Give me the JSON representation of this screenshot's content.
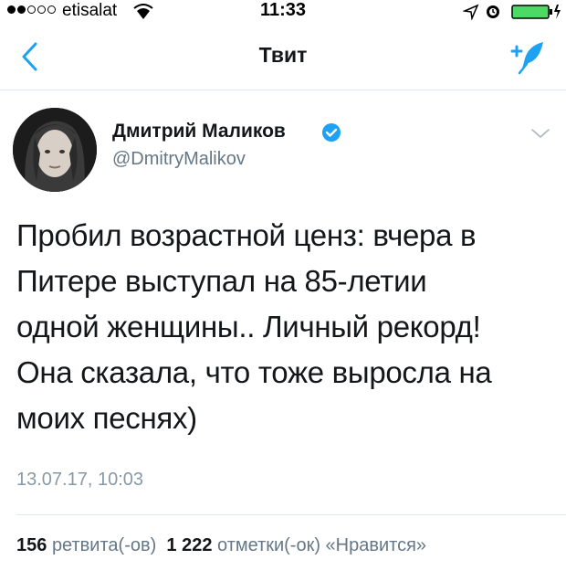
{
  "status_bar": {
    "carrier": "etisalat",
    "time": "11:33"
  },
  "nav": {
    "title": "Твит",
    "back_icon": "chevron-left-icon",
    "compose_icon": "compose-tweet-icon"
  },
  "tweet": {
    "author_name": "Дмитрий Маликов",
    "author_handle": "@DmitryMalikov",
    "verified": true,
    "text_lines": [
      "Пробил возрастной ценз: вчера в",
      "Питере выступал на 85-летии",
      "одной женщины.. Личный рекорд!",
      "Она сказала, что тоже выросла на",
      "моих песнях)"
    ],
    "timestamp": "13.07.17, 10:03",
    "retweets_count": "156",
    "retweets_label": "ретвита(-ов)",
    "likes_count": "1 222",
    "likes_label": "отметки(-ок) «Нравится»"
  },
  "colors": {
    "accent": "#1da1f2",
    "muted": "#657786",
    "timestamp": "#8899a6",
    "divider": "#e1e8ed"
  }
}
